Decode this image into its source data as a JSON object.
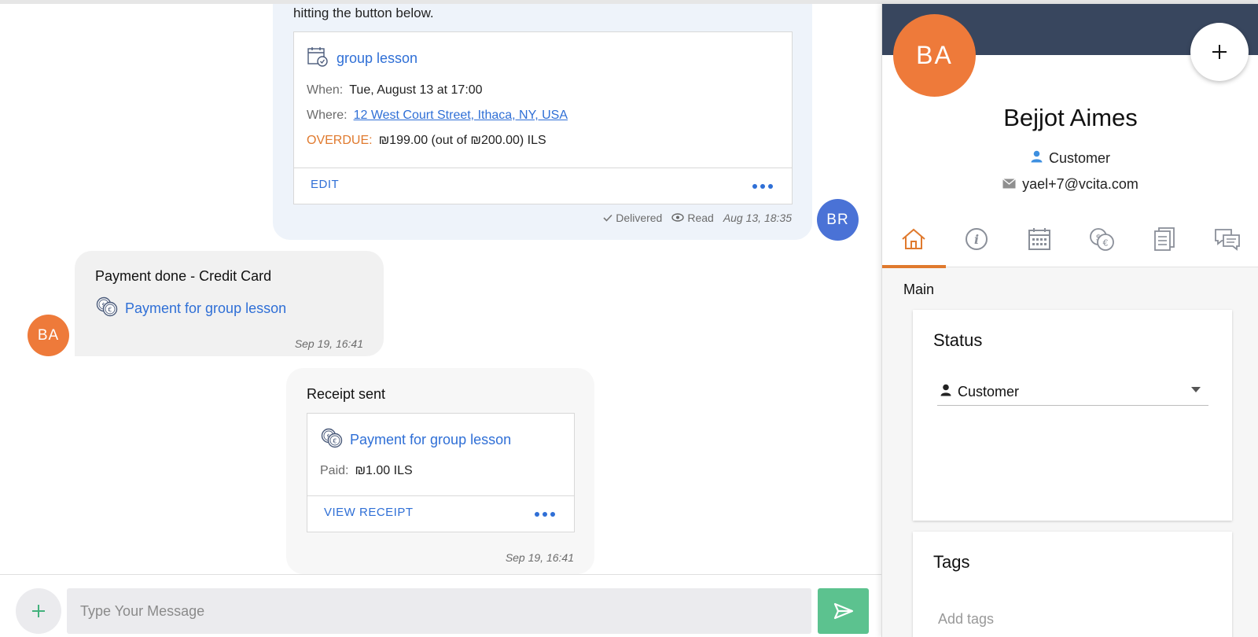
{
  "chat": {
    "appointment_message": {
      "intro_text": "hitting the button below.",
      "card": {
        "title": "group lesson",
        "when_label": "When:",
        "when_value": "Tue, August 13 at 17:00",
        "where_label": "Where:",
        "where_value": "12 West Court Street, Ithaca, NY, USA",
        "overdue_label": "OVERDUE:",
        "overdue_value": "₪199.00 (out of ₪200.00) ILS",
        "edit_label": "EDIT"
      },
      "status_delivered": "Delivered",
      "status_read": "Read",
      "timestamp": "Aug 13, 18:35",
      "sender_initials": "BR"
    },
    "payment_message": {
      "title": "Payment done - Credit Card",
      "link": "Payment for group lesson",
      "timestamp": "Sep 19, 16:41",
      "sender_initials": "BA"
    },
    "receipt_message": {
      "title": "Receipt sent",
      "card": {
        "link": "Payment for group lesson",
        "paid_label": "Paid:",
        "paid_value": "₪1.00 ILS",
        "view_receipt_label": "VIEW RECEIPT"
      },
      "timestamp": "Sep 19, 16:41"
    }
  },
  "composer": {
    "placeholder": "Type Your Message",
    "value": ""
  },
  "client_panel": {
    "initials": "BA",
    "name": "Bejjot Aimes",
    "role": "Customer",
    "email": "yael+7@vcita.com",
    "tabs": [
      {
        "icon": "home-icon",
        "active": true
      },
      {
        "icon": "info-icon",
        "active": false
      },
      {
        "icon": "calendar-icon",
        "active": false
      },
      {
        "icon": "payments-icon",
        "active": false
      },
      {
        "icon": "documents-icon",
        "active": false
      },
      {
        "icon": "messages-icon",
        "active": false
      }
    ],
    "section_label": "Main",
    "status": {
      "title": "Status",
      "selected": "Customer"
    },
    "tags": {
      "title": "Tags",
      "placeholder": "Add tags"
    }
  },
  "colors": {
    "accent_blue": "#2f6fd6",
    "overdue_orange": "#e07a2e",
    "avatar_orange": "#ee7a3a",
    "avatar_blue": "#4a72d6",
    "send_green": "#5cc28f",
    "panel_header": "#38465e"
  }
}
